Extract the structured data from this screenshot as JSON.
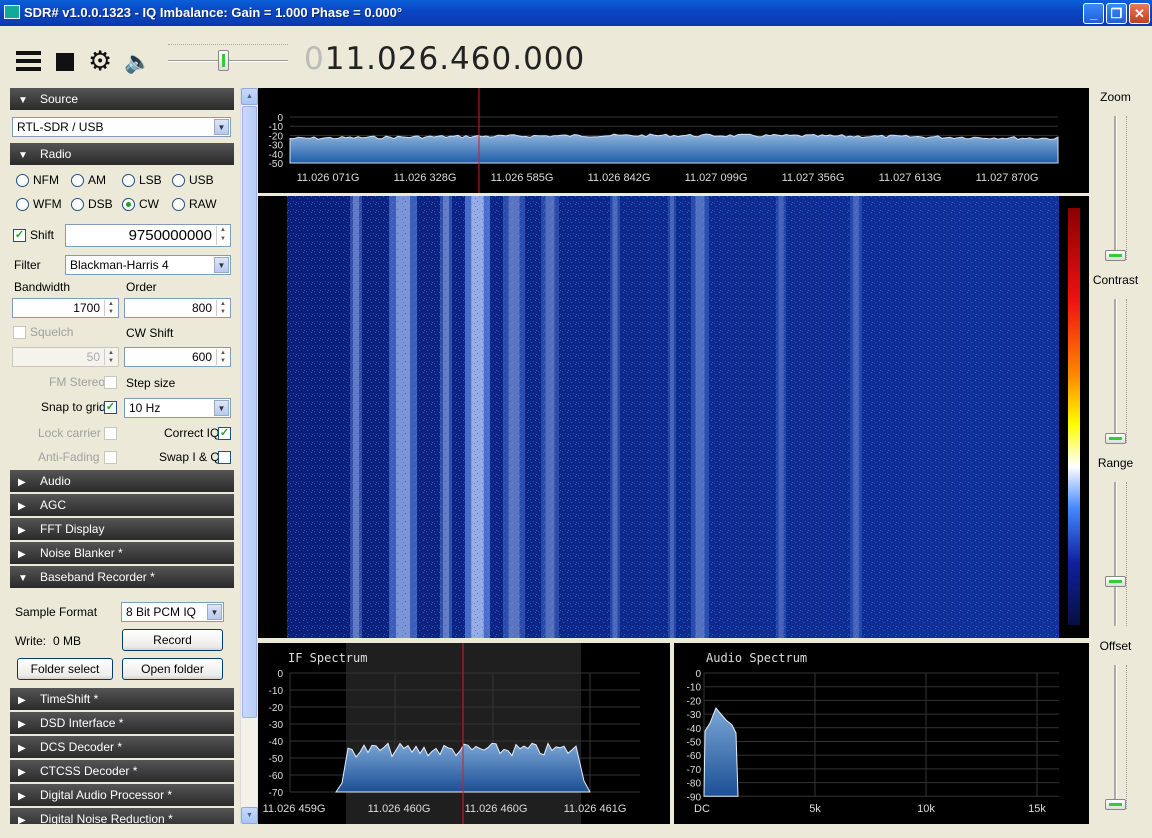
{
  "window": {
    "title": "SDR# v1.0.0.1323 - IQ Imbalance: Gain = 1.000 Phase = 0.000°",
    "min_icon": "minimize-icon",
    "max_icon": "maximize-icon",
    "close_icon": "close-icon",
    "min_glyph": "_",
    "max_glyph": "❐",
    "close_glyph": "✕"
  },
  "toolbar": {
    "frequency_dim": "0",
    "frequency_main": "11.026.460.000",
    "volume_level": 0.45,
    "menu_icon": "hamburger-menu-icon",
    "stop_icon": "stop-icon",
    "settings_icon": "gear-icon",
    "audio_icon": "speaker-icon",
    "gear_glyph": "⚙",
    "speaker_glyph": "🔈"
  },
  "sidebar": {
    "source": {
      "label": "Source",
      "expanded": true,
      "device": "RTL-SDR / USB"
    },
    "radio": {
      "label": "Radio",
      "expanded": true,
      "modes": [
        "NFM",
        "AM",
        "LSB",
        "USB",
        "WFM",
        "DSB",
        "CW",
        "RAW"
      ],
      "selected_mode": "CW",
      "shift_label": "Shift",
      "shift_checked": true,
      "shift_value": "9750000000",
      "filter_label": "Filter",
      "filter_value": "Blackman-Harris 4",
      "bandwidth_label": "Bandwidth",
      "bandwidth_value": "1700",
      "order_label": "Order",
      "order_value": "800",
      "squelch_label": "Squelch",
      "squelch_value": "50",
      "cw_shift_label": "CW Shift",
      "cw_shift_value": "600",
      "fm_stereo_label": "FM Stereo",
      "step_size_label": "Step size",
      "snap_label": "Snap to grid",
      "snap_checked": true,
      "step_value": "10 Hz",
      "lock_carrier_label": "Lock carrier",
      "correct_iq_label": "Correct IQ",
      "correct_iq_checked": true,
      "anti_fading_label": "Anti-Fading",
      "swap_iq_label": "Swap I & Q"
    },
    "collapsed_panels": [
      "Audio",
      "AGC",
      "FFT Display",
      "Noise Blanker *"
    ],
    "baseband_recorder": {
      "label": "Baseband Recorder *",
      "sample_format_label": "Sample Format",
      "sample_format_value": "8 Bit PCM IQ",
      "write_label": "Write:",
      "write_value": "0 MB",
      "record_button": "Record",
      "folder_select_button": "Folder select",
      "open_folder_button": "Open folder"
    },
    "more_panels": [
      "TimeShift *",
      "DSD Interface *",
      "DCS Decoder *",
      "CTCSS Decoder *",
      "Digital Audio Processor *",
      "Digital Noise Reduction *"
    ],
    "expanded_glyph": "▼",
    "collapsed_glyph": "▶"
  },
  "spectrum": {
    "y_ticks": [
      "0",
      "-10",
      "-20",
      "-30",
      "-40",
      "-50"
    ],
    "x_ticks": [
      "11.026 071G",
      "11.026 328G",
      "11.026 585G",
      "11.026 842G",
      "11.027 099G",
      "11.027 356G",
      "11.027 613G",
      "11.027 870G"
    ],
    "colors": {
      "fill": "#2e6fb8",
      "cursor": "#d02020"
    }
  },
  "if_spectrum": {
    "title": "IF Spectrum",
    "y_ticks": [
      "0",
      "-10",
      "-20",
      "-30",
      "-40",
      "-50",
      "-60",
      "-70"
    ],
    "x_ticks": [
      "11.026 459G",
      "11.026 460G",
      "11.026 460G",
      "11.026 461G"
    ]
  },
  "audio_spectrum": {
    "title": "Audio Spectrum",
    "y_ticks": [
      "0",
      "-10",
      "-20",
      "-30",
      "-40",
      "-50",
      "-60",
      "-70",
      "-80",
      "-90"
    ],
    "x_ticks": [
      "DC",
      "5k",
      "10k",
      "15k"
    ]
  },
  "right_panel": {
    "zoom_label": "Zoom",
    "contrast_label": "Contrast",
    "range_label": "Range",
    "offset_label": "Offset",
    "zoom_level": 0.0,
    "contrast_level": 0.0,
    "range_level": 0.3,
    "offset_level": 0.0
  }
}
